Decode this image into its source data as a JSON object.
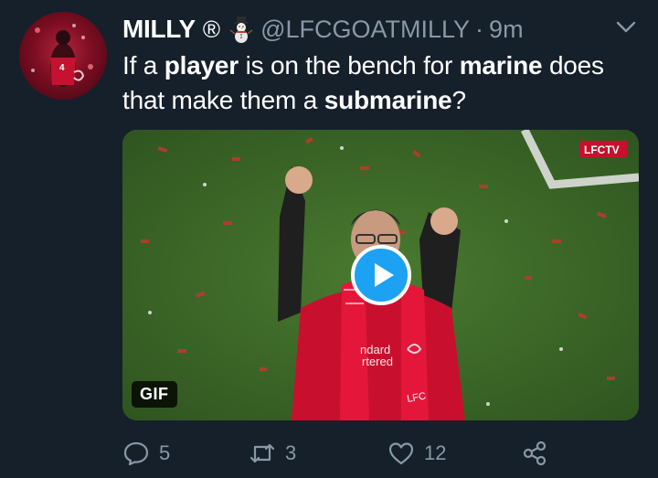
{
  "tweet": {
    "display_name": "MILLY",
    "name_symbol": "®",
    "emoji": "snowman-icon",
    "handle": "@LFCGOATMILLY",
    "separator": "·",
    "time": "9m",
    "text_parts": [
      {
        "text": "If a ",
        "bold": false
      },
      {
        "text": "player",
        "bold": true
      },
      {
        "text": " is on the bench for ",
        "bold": false
      },
      {
        "text": "marine",
        "bold": true
      },
      {
        "text": " does that make them a ",
        "bold": false
      },
      {
        "text": "submarine",
        "bold": true
      },
      {
        "text": "?",
        "bold": false
      }
    ]
  },
  "media": {
    "badge": "GIF",
    "watermark": "LFCTV",
    "shirt_text_1": "ndard",
    "shirt_text_2": "rtered",
    "scarf_text": "LFC"
  },
  "actions": {
    "replies": "5",
    "retweets": "3",
    "likes": "12"
  },
  "colors": {
    "background": "#15202b",
    "secondary_text": "#8899a6",
    "accent": "#1da1f2"
  }
}
